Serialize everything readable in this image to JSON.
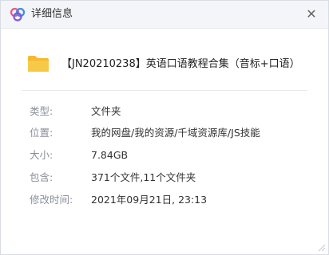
{
  "window": {
    "title": "详细信息",
    "close_symbol": "✕"
  },
  "file": {
    "name": "【JN20210238】英语口语教程合集（音标+口语）"
  },
  "properties": [
    {
      "label": "类型:",
      "value": "文件夹"
    },
    {
      "label": "位置:",
      "value": "我的网盘/我的资源/千域资源库/JS技能"
    },
    {
      "label": "大小:",
      "value": "7.84GB"
    },
    {
      "label": "包含:",
      "value": "371个文件,11个文件夹"
    },
    {
      "label": "修改时间:",
      "value": "2021年09月21日, 23:13"
    }
  ],
  "colors": {
    "folder": "#f7c948",
    "logo_pink": "#e65a8a",
    "logo_blue": "#3a8ee6",
    "logo_purple": "#7a5be0"
  }
}
